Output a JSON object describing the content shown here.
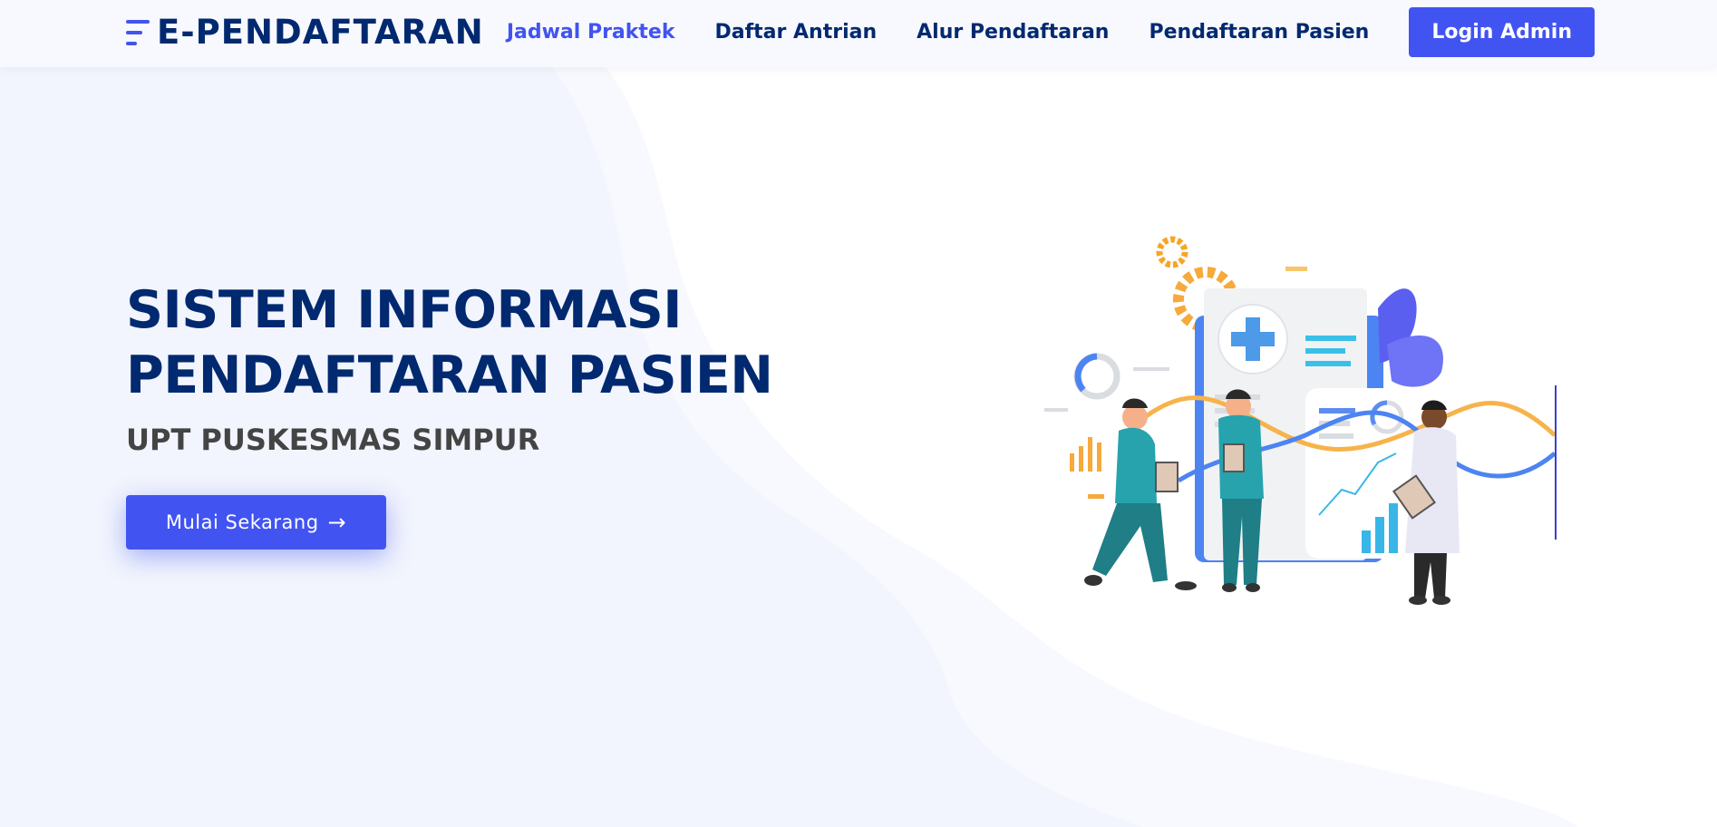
{
  "header": {
    "brand": "E-PENDAFTARAN",
    "nav": [
      {
        "label": "Jadwal Praktek",
        "active": true
      },
      {
        "label": "Daftar Antrian",
        "active": false
      },
      {
        "label": "Alur Pendaftaran",
        "active": false
      },
      {
        "label": "Pendaftaran Pasien",
        "active": false
      }
    ],
    "cta_label": "Login Admin"
  },
  "hero": {
    "title_line1": "SISTEM INFORMASI",
    "title_line2": "PENDAFTARAN PASIEN",
    "subtitle": "UPT PUSKESMAS SIMPUR",
    "button_label": "Mulai Sekarang",
    "button_icon": "arrow-right-icon"
  },
  "colors": {
    "primary": "#4154f1",
    "heading": "#012970",
    "text": "#444444",
    "background": "#ffffff",
    "wave_light": "#f7f9fe",
    "wave_main": "#f2f5fd"
  },
  "illustration": "medical-team-illustration"
}
